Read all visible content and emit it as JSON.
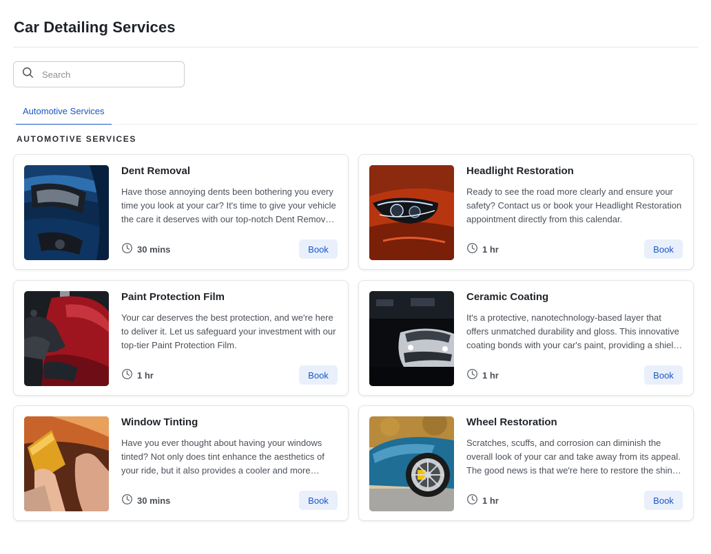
{
  "page": {
    "title": "Car Detailing Services"
  },
  "search": {
    "placeholder": "Search",
    "value": ""
  },
  "tabs": [
    {
      "label": "Automotive Services",
      "active": true
    }
  ],
  "section": {
    "heading": "AUTOMOTIVE SERVICES"
  },
  "colors": {
    "accent": "#1a56c4",
    "book_bg": "#e9f0fc"
  },
  "services": [
    {
      "title": "Dent Removal",
      "description": "Have those annoying dents been bothering you every time you look at your car? It's time to give your vehicle the care it deserves with our top-notch Dent Removal service.",
      "duration": "30 mins",
      "button": "Book"
    },
    {
      "title": "Headlight Restoration",
      "description": "Ready to see the road more clearly and ensure your safety? Contact us or book your Headlight Restoration appointment directly from this calendar.",
      "duration": "1 hr",
      "button": "Book"
    },
    {
      "title": "Paint Protection Film",
      "description": "Your car deserves the best protection, and we're here to deliver it. Let us safeguard your investment with our top-tier Paint Protection Film.",
      "duration": "1 hr",
      "button": "Book"
    },
    {
      "title": "Ceramic Coating",
      "description": "It's a protective, nanotechnology-based layer that offers unmatched durability and gloss. This innovative coating bonds with your car's paint, providing a shield against the elements.",
      "duration": "1 hr",
      "button": "Book"
    },
    {
      "title": "Window Tinting",
      "description": "Have you ever thought about having your windows tinted? Not only does tint enhance the aesthetics of your ride, but it also provides a cooler and more comfortable driving experience.",
      "duration": "30 mins",
      "button": "Book"
    },
    {
      "title": "Wheel Restoration",
      "description": "Scratches, scuffs, and corrosion can diminish the overall look of your car and take away from its appeal. The good news is that we're here to restore the shine to your wheels.",
      "duration": "1 hr",
      "button": "Book"
    }
  ]
}
